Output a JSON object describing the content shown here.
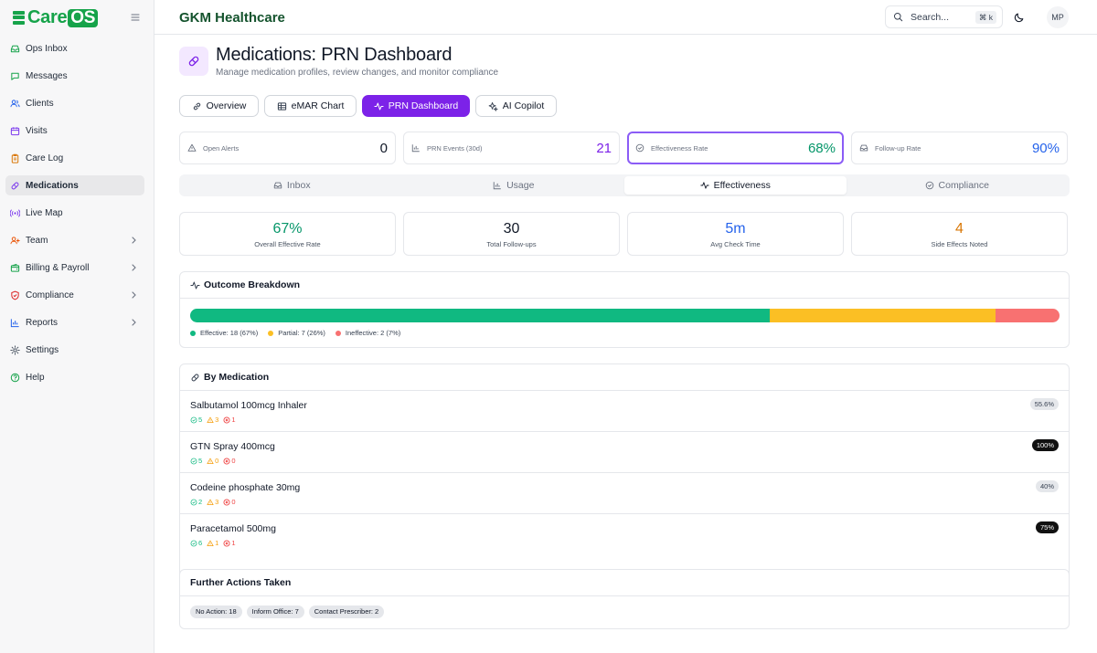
{
  "app": {
    "logo_care": "Care",
    "logo_os": "OS"
  },
  "sidebar": {
    "items": [
      {
        "label": "Ops Inbox",
        "icon": "inbox-icon",
        "active": false,
        "chevron": false
      },
      {
        "label": "Messages",
        "icon": "message-icon",
        "active": false,
        "chevron": false
      },
      {
        "label": "Clients",
        "icon": "users-icon",
        "active": false,
        "chevron": false
      },
      {
        "label": "Visits",
        "icon": "calendar-icon",
        "active": false,
        "chevron": false
      },
      {
        "label": "Care Log",
        "icon": "clipboard-icon",
        "active": false,
        "chevron": false
      },
      {
        "label": "Medications",
        "icon": "pill-icon",
        "active": true,
        "chevron": false
      },
      {
        "label": "Live Map",
        "icon": "radio-icon",
        "active": false,
        "chevron": false
      },
      {
        "label": "Team",
        "icon": "team-icon",
        "active": false,
        "chevron": true
      },
      {
        "label": "Billing & Payroll",
        "icon": "wallet-icon",
        "active": false,
        "chevron": true
      },
      {
        "label": "Compliance",
        "icon": "shield-icon",
        "active": false,
        "chevron": true
      },
      {
        "label": "Reports",
        "icon": "bar-chart-icon",
        "active": false,
        "chevron": true
      },
      {
        "label": "Settings",
        "icon": "gear-icon",
        "active": false,
        "chevron": false
      },
      {
        "label": "Help",
        "icon": "help-icon",
        "active": false,
        "chevron": false
      }
    ]
  },
  "header": {
    "org_name": "GKM Healthcare",
    "search_placeholder": "Search...",
    "search_shortcut": "⌘ k",
    "avatar_initials": "MP"
  },
  "page": {
    "title": "Medications: PRN Dashboard",
    "subtitle": "Manage medication profiles, review changes, and monitor compliance"
  },
  "top_tabs": [
    {
      "label": "Overview",
      "icon": "link-icon",
      "active": false
    },
    {
      "label": "eMAR Chart",
      "icon": "table-icon",
      "active": false
    },
    {
      "label": "PRN Dashboard",
      "icon": "activity-icon",
      "active": true
    },
    {
      "label": "AI Copilot",
      "icon": "sparkles-icon",
      "active": false
    }
  ],
  "stats": [
    {
      "label": "Open Alerts",
      "value": "0",
      "icon": "alert-triangle-icon",
      "color": "#111827",
      "active": false
    },
    {
      "label": "PRN Events (30d)",
      "value": "21",
      "icon": "bar-chart-icon",
      "color": "#7c22e8",
      "active": false
    },
    {
      "label": "Effectiveness Rate",
      "value": "68%",
      "icon": "check-circle-icon",
      "color": "#059669",
      "active": true
    },
    {
      "label": "Follow-up Rate",
      "value": "90%",
      "icon": "inbox-icon",
      "color": "#2563eb",
      "active": false
    }
  ],
  "sub_tabs": [
    {
      "label": "Inbox",
      "icon": "inbox-icon",
      "active": false
    },
    {
      "label": "Usage",
      "icon": "bar-chart-icon",
      "active": false
    },
    {
      "label": "Effectiveness",
      "icon": "activity-icon",
      "active": true
    },
    {
      "label": "Compliance",
      "icon": "check-circle-icon",
      "active": false
    }
  ],
  "metrics": [
    {
      "value": "67%",
      "label": "Overall Effective Rate",
      "color": "#059669"
    },
    {
      "value": "30",
      "label": "Total Follow-ups",
      "color": "#111827"
    },
    {
      "value": "5m",
      "label": "Avg Check Time",
      "color": "#2563eb"
    },
    {
      "value": "4",
      "label": "Side Effects Noted",
      "color": "#d97706"
    }
  ],
  "outcome": {
    "title": "Outcome Breakdown",
    "segments": [
      {
        "label": "Effective: 18 (67%)",
        "fraction": 0.667,
        "color": "#10b981"
      },
      {
        "label": "Partial: 7 (26%)",
        "fraction": 0.259,
        "color": "#fbbf24"
      },
      {
        "label": "Ineffective: 2 (7%)",
        "fraction": 0.074,
        "color": "#f87171"
      }
    ]
  },
  "by_medication": {
    "title": "By Medication",
    "rows": [
      {
        "name": "Salbutamol 100mcg Inhaler",
        "effective": "5",
        "partial": "3",
        "ineffective": "1",
        "pct": "55.6%",
        "badge": "grey"
      },
      {
        "name": "GTN Spray 400mcg",
        "effective": "5",
        "partial": "0",
        "ineffective": "0",
        "pct": "100%",
        "badge": "black"
      },
      {
        "name": "Codeine phosphate 30mg",
        "effective": "2",
        "partial": "3",
        "ineffective": "0",
        "pct": "40%",
        "badge": "grey"
      },
      {
        "name": "Paracetamol 500mg",
        "effective": "6",
        "partial": "1",
        "ineffective": "1",
        "pct": "75%",
        "badge": "black"
      }
    ]
  },
  "further_actions": {
    "title": "Further Actions Taken",
    "chips": [
      "No Action: 18",
      "Inform Office: 7",
      "Contact Prescriber: 2"
    ]
  }
}
